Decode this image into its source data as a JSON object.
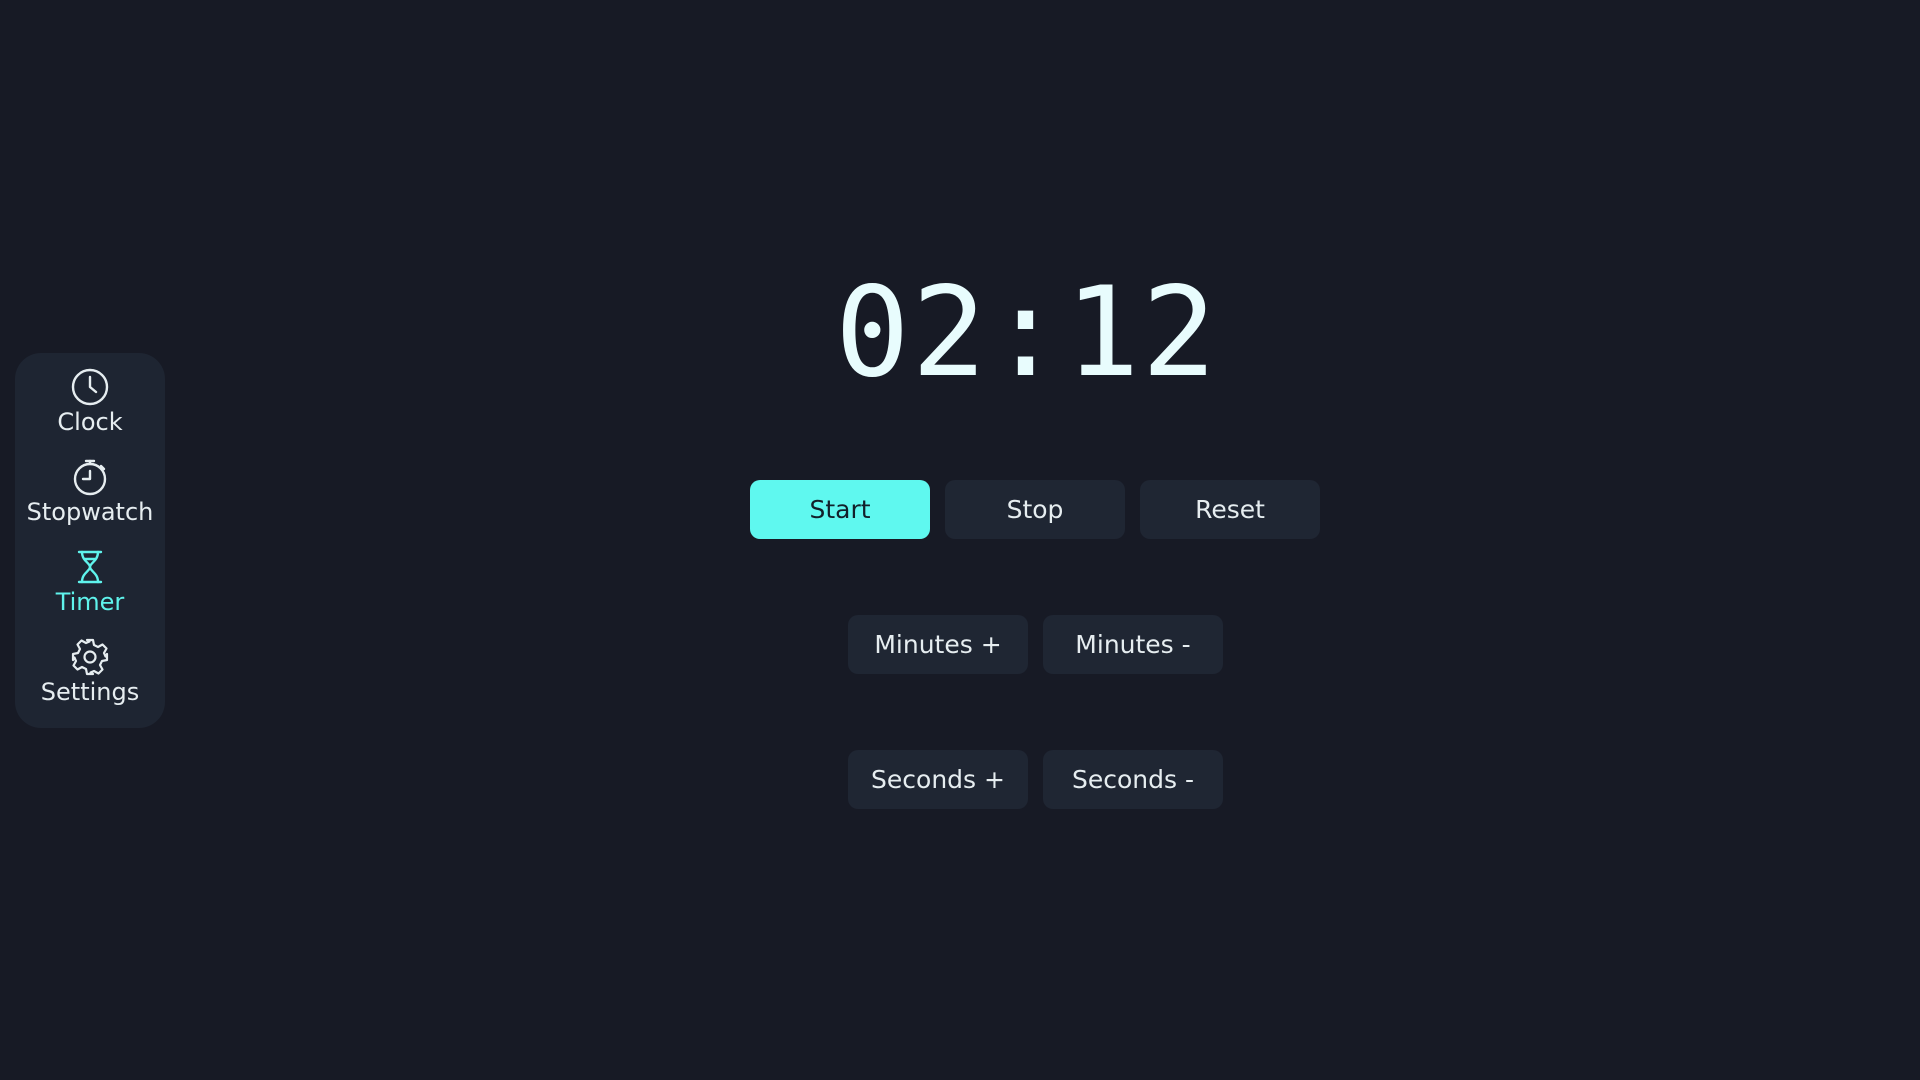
{
  "sidebar": {
    "items": [
      {
        "label": "Clock",
        "icon": "clock-icon",
        "active": false
      },
      {
        "label": "Stopwatch",
        "icon": "stopwatch-icon",
        "active": false
      },
      {
        "label": "Timer",
        "icon": "hourglass-icon",
        "active": true
      },
      {
        "label": "Settings",
        "icon": "gear-icon",
        "active": false
      }
    ]
  },
  "timer": {
    "display": "02:12"
  },
  "controls": {
    "start_label": "Start",
    "stop_label": "Stop",
    "reset_label": "Reset"
  },
  "adjust": {
    "minutes_plus_label": "Minutes +",
    "minutes_minus_label": "Minutes -",
    "seconds_plus_label": "Seconds +",
    "seconds_minus_label": "Seconds -"
  },
  "colors": {
    "background": "#171a25",
    "panel": "#1e2532",
    "accent": "#5ff8ef",
    "text": "#e6edf0"
  }
}
